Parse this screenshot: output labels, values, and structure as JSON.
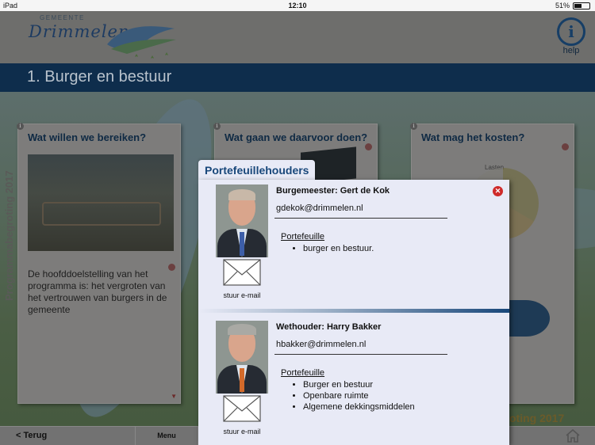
{
  "status": {
    "device": "iPad",
    "time": "12:10",
    "battery": "51%",
    "battery_level": 0.51
  },
  "header": {
    "logo_small": "GEMEENTE",
    "logo_name": "Drimmelen",
    "help_label": "help",
    "help_glyph": "i"
  },
  "titlebar": {
    "title": "1. Burger en bestuur"
  },
  "side_text": "Programmabegroting 2017",
  "cards": [
    {
      "title": "Wat willen we bereiken?",
      "text": "De hoofddoelstelling van het programma is: het vergroten van het vertrouwen van burgers in de gemeente"
    },
    {
      "title": "Wat gaan we daarvoor doen?"
    },
    {
      "title": "Wat mag het kosten?",
      "chart_label": "Lasten"
    }
  ],
  "bottom_brand": "groting 2017",
  "bottombar": {
    "back": "< Terug",
    "menu": "Menu"
  },
  "popup": {
    "tab": "Portefeuillehouders",
    "mail_label": "stuur e-mail",
    "portfolio_label": "Portefeuille",
    "persons": [
      {
        "role": "Burgemeester: Gert de Kok",
        "email": "gdekok@drimmelen.nl",
        "portfolio": [
          "burger en bestuur."
        ]
      },
      {
        "role": "Wethouder: Harry Bakker",
        "email": "hbakker@drimmelen.nl",
        "portfolio": [
          "Burger en bestuur",
          "Openbare ruimte",
          "Algemene dekkingsmiddelen"
        ]
      }
    ]
  },
  "colors": {
    "title_bar": "#0e2d4c",
    "popup_bg": "#e8eaf6",
    "popup_tab_text": "#18477a",
    "close_red": "#cf2a2a"
  }
}
